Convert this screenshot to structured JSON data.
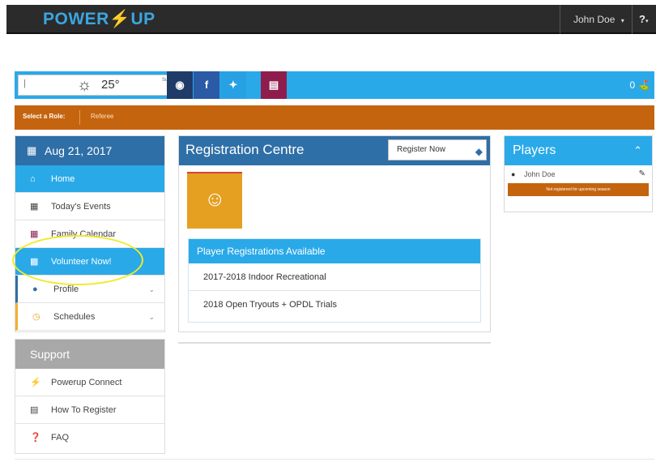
{
  "app": {
    "logo_text": "POWER",
    "logo_bolt": "⚡",
    "logo_text2": "UP",
    "user_name": "John Doe",
    "help_label": "?"
  },
  "toolbar": {
    "weather_temp": "25°",
    "weather_desc": "Sunny",
    "cart_count": "0"
  },
  "role": {
    "label": "Select a Role:",
    "value": "Referee"
  },
  "sidebar": {
    "date": "Aug 21, 2017",
    "items": [
      {
        "label": "Home",
        "icon": "home-icon"
      },
      {
        "label": "Today's Events",
        "icon": "calendar-icon"
      },
      {
        "label": "Family Calendar",
        "icon": "calendar-icon"
      },
      {
        "label": "Volunteer Now!",
        "icon": "volunteer-icon"
      },
      {
        "label": "Profile",
        "icon": "user-icon"
      },
      {
        "label": "Schedules",
        "icon": "clock-icon"
      }
    ]
  },
  "support": {
    "title": "Support",
    "items": [
      {
        "label": "Powerup Connect",
        "icon": "bolt-icon"
      },
      {
        "label": "How To Register",
        "icon": "document-icon"
      },
      {
        "label": "FAQ",
        "icon": "question-icon"
      }
    ]
  },
  "registration": {
    "title": "Registration Centre",
    "register_button": "Register Now",
    "available_title": "Player Registrations Available",
    "items": [
      "2017-2018 Indoor Recreational",
      "2018 Open Tryouts + OPDL Trials"
    ]
  },
  "players": {
    "title": "Players",
    "player_name": "John Doe",
    "status": "Not registered for upcoming season"
  },
  "colors": {
    "primary": "#2aa9e8",
    "dark_blue": "#2f6fa7",
    "orange": "#c4640e",
    "highlight": "#f1ea2a"
  }
}
